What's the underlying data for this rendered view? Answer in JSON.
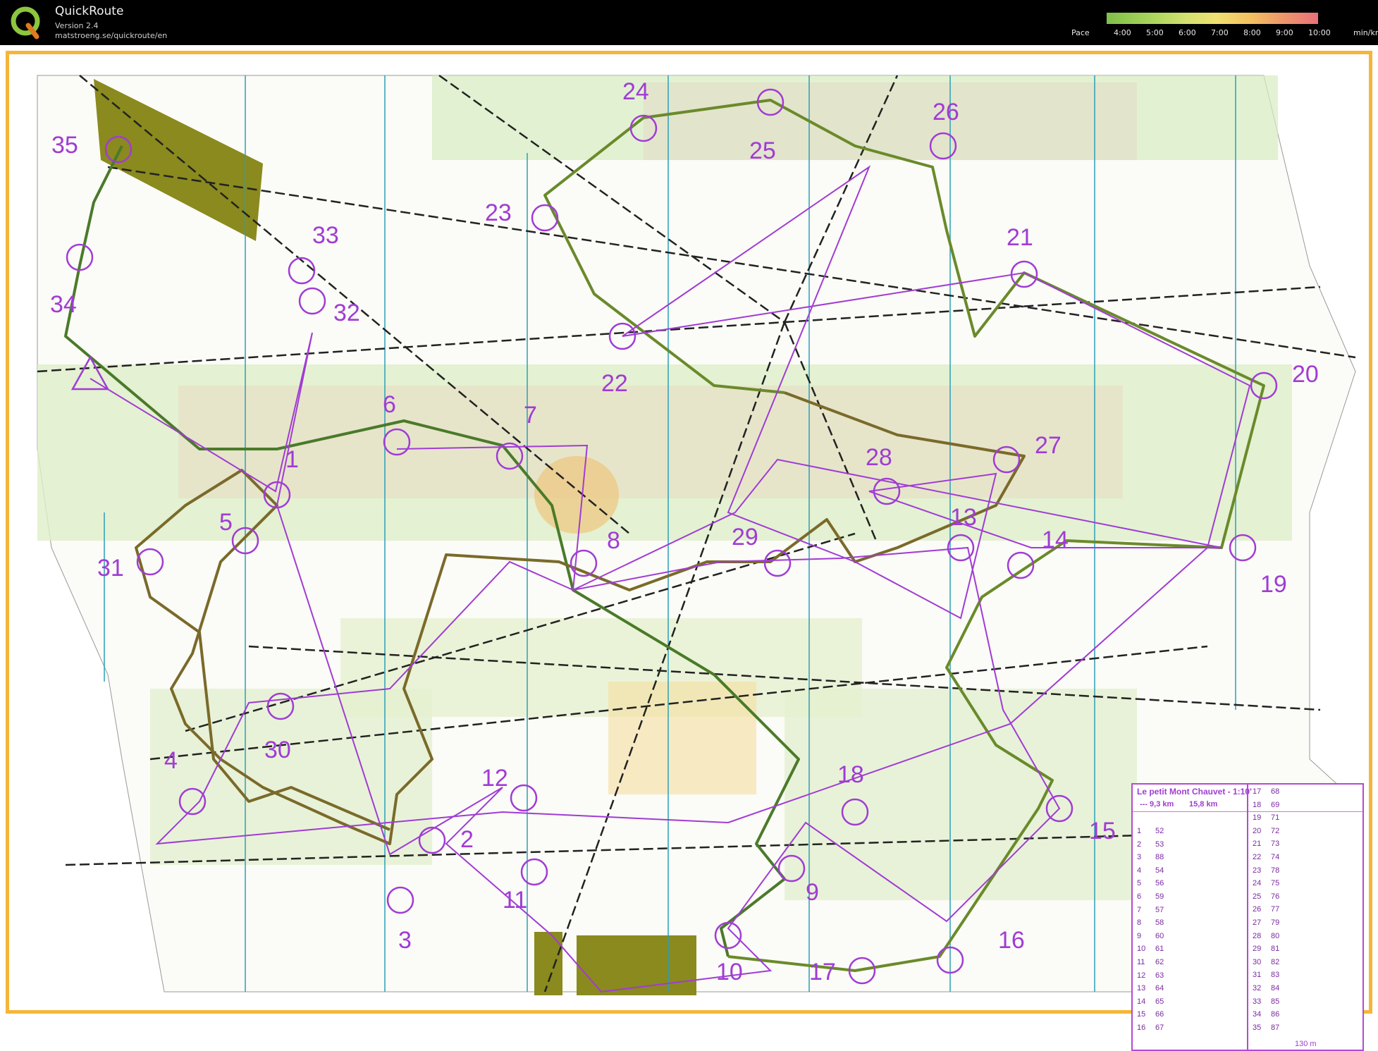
{
  "app": {
    "title": "QuickRoute",
    "version": "Version 2.4",
    "url": "matstroeng.se/quickroute/en"
  },
  "pace": {
    "label": "Pace",
    "ticks": [
      "4:00",
      "5:00",
      "6:00",
      "7:00",
      "8:00",
      "9:00",
      "10:00"
    ],
    "unit": "min/km",
    "colors": [
      "#7fbf4a",
      "#d4e070",
      "#f3c060",
      "#e8707a"
    ]
  },
  "colors": {
    "frame": "#f5b638",
    "course": "#a03cd4",
    "route": "#3a6a2a",
    "magnetic_north": "#2aa0b8"
  },
  "controls": [
    {
      "label": "35"
    },
    {
      "label": "24"
    },
    {
      "label": "26"
    },
    {
      "label": "25"
    },
    {
      "label": "23"
    },
    {
      "label": "33"
    },
    {
      "label": "34"
    },
    {
      "label": "32"
    },
    {
      "label": "21"
    },
    {
      "label": "22"
    },
    {
      "label": "20"
    },
    {
      "label": "6"
    },
    {
      "label": "7"
    },
    {
      "label": "1"
    },
    {
      "label": "28"
    },
    {
      "label": "27"
    },
    {
      "label": "5"
    },
    {
      "label": "13"
    },
    {
      "label": "14"
    },
    {
      "label": "31"
    },
    {
      "label": "8"
    },
    {
      "label": "29"
    },
    {
      "label": "19"
    },
    {
      "label": "30"
    },
    {
      "label": "4"
    },
    {
      "label": "12"
    },
    {
      "label": "18"
    },
    {
      "label": "15"
    },
    {
      "label": "2"
    },
    {
      "label": "9"
    },
    {
      "label": "11"
    },
    {
      "label": "3"
    },
    {
      "label": "16"
    },
    {
      "label": "10"
    },
    {
      "label": "17"
    }
  ],
  "legend": {
    "title": "Le petit Mont Chauvet - 1:10'",
    "length_a": "--- 9,3 km",
    "length_b": "15,8 km",
    "scale": "130 m",
    "left_rows": [
      {
        "n": "1",
        "code": "52"
      },
      {
        "n": "2",
        "code": "53"
      },
      {
        "n": "3",
        "code": "88"
      },
      {
        "n": "4",
        "code": "54"
      },
      {
        "n": "5",
        "code": "56"
      },
      {
        "n": "6",
        "code": "59"
      },
      {
        "n": "7",
        "code": "57"
      },
      {
        "n": "8",
        "code": "58"
      },
      {
        "n": "9",
        "code": "60"
      },
      {
        "n": "10",
        "code": "61"
      },
      {
        "n": "11",
        "code": "62"
      },
      {
        "n": "12",
        "code": "63"
      },
      {
        "n": "13",
        "code": "64"
      },
      {
        "n": "14",
        "code": "65"
      },
      {
        "n": "15",
        "code": "66"
      },
      {
        "n": "16",
        "code": "67"
      }
    ],
    "right_rows": [
      {
        "n": "17",
        "code": "68"
      },
      {
        "n": "18",
        "code": "69"
      },
      {
        "n": "19",
        "code": "71"
      },
      {
        "n": "20",
        "code": "72"
      },
      {
        "n": "21",
        "code": "73"
      },
      {
        "n": "22",
        "code": "74"
      },
      {
        "n": "23",
        "code": "78"
      },
      {
        "n": "24",
        "code": "75"
      },
      {
        "n": "25",
        "code": "76"
      },
      {
        "n": "26",
        "code": "77"
      },
      {
        "n": "27",
        "code": "79"
      },
      {
        "n": "28",
        "code": "80"
      },
      {
        "n": "29",
        "code": "81"
      },
      {
        "n": "30",
        "code": "82"
      },
      {
        "n": "31",
        "code": "83"
      },
      {
        "n": "32",
        "code": "84"
      },
      {
        "n": "33",
        "code": "85"
      },
      {
        "n": "34",
        "code": "86"
      },
      {
        "n": "35",
        "code": "87"
      }
    ]
  }
}
